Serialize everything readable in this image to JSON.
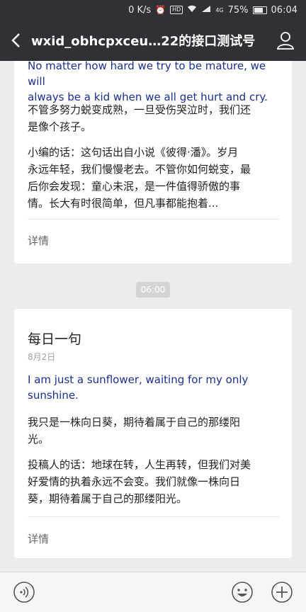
{
  "status_bar": {
    "net_speed": "0 K/s",
    "hd_label": "HD",
    "signal_label": "4G",
    "battery": "75%",
    "battery_level": 0.75,
    "time": "06:04"
  },
  "header": {
    "title": "wxid_obhcpxceu…22的接口测试号"
  },
  "card1": {
    "english_lines": [
      "No matter how hard we try to be mature, we will",
      "always be a kid when we all get hurt and cry."
    ],
    "chinese_lines": [
      "不管多努力蜕变成熟，一旦受伤哭泣时，我们还",
      "是像个孩子。"
    ],
    "comment_lines": [
      "小编的话：这句话出自小说《彼得·潘》。岁月",
      "永远年轻，我们慢慢老去。不管你如何蜕变，最",
      "后你会发现：童心未泯，是一件值得骄傲的事",
      "情。长大有时很简单，但凡事都能抱着..."
    ],
    "detail_label": "详情"
  },
  "timestamp": "06:00",
  "card2": {
    "title": "每日一句",
    "date": "8月2日",
    "english_lines": [
      "I am just a sunflower, waiting for my only",
      "sunshine."
    ],
    "chinese_lines": [
      "我只是一株向日葵，期待着属于自己的那缕阳",
      "光。"
    ],
    "comment_lines": [
      "投稿人的话：地球在转，人生再转，但我们对美",
      "好爱情的执着永远不会变。我们就像一株向日",
      "葵，期待着属于自己的那缕阳光。"
    ],
    "detail_label": "详情"
  },
  "icons": {
    "back": "chevron-left-icon",
    "profile": "person-icon",
    "voice": "voice-icon",
    "emoji": "emoji-icon",
    "add": "add-icon"
  }
}
